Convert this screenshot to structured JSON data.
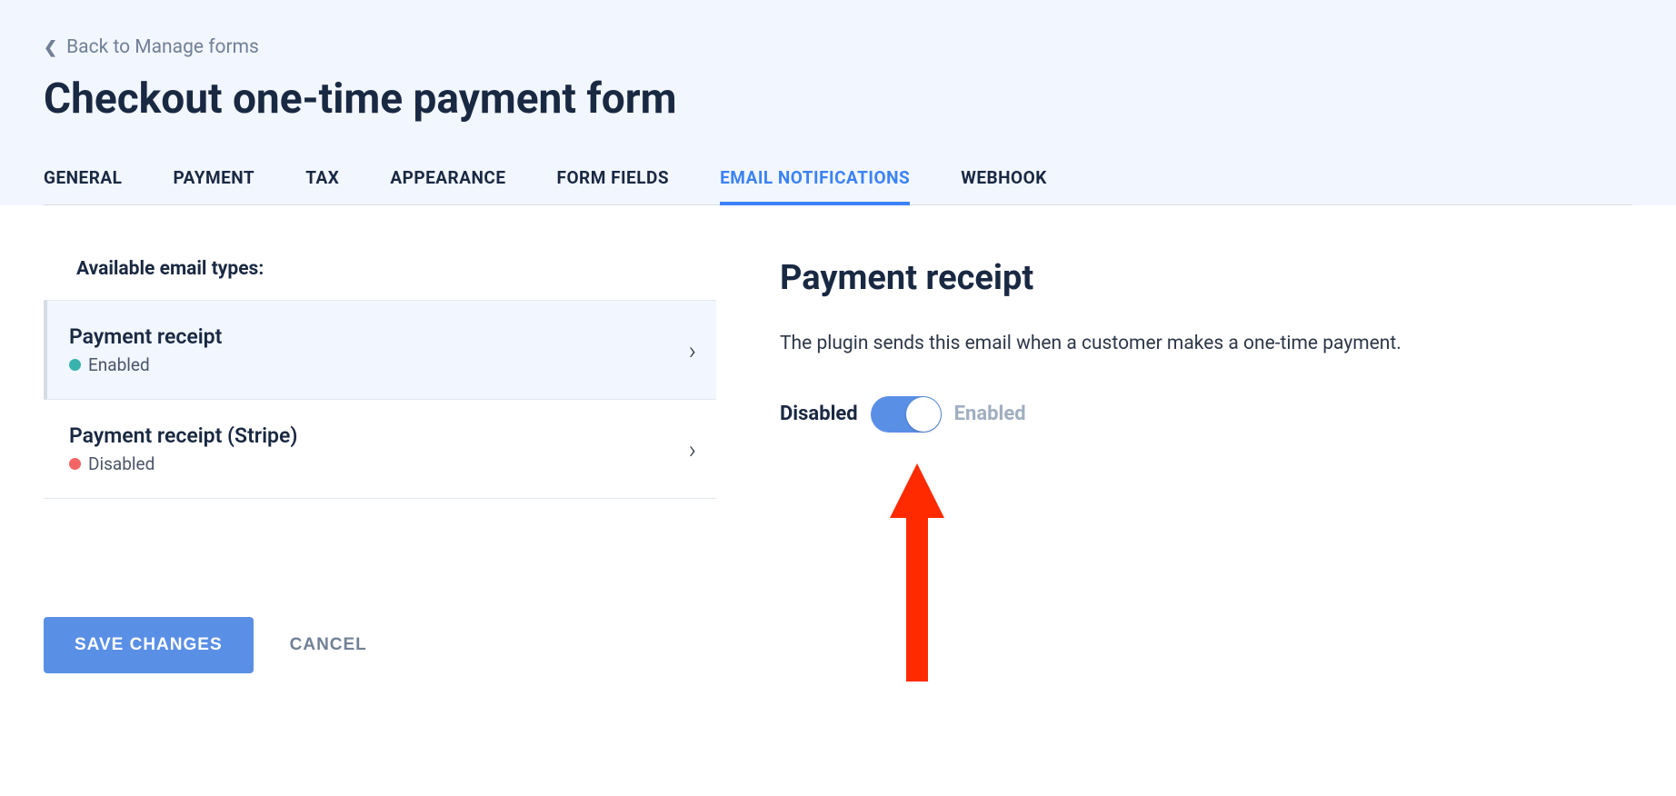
{
  "back_link": "Back to Manage forms",
  "page_title": "Checkout one-time payment form",
  "tabs": [
    {
      "label": "GENERAL",
      "active": false
    },
    {
      "label": "PAYMENT",
      "active": false
    },
    {
      "label": "TAX",
      "active": false
    },
    {
      "label": "APPEARANCE",
      "active": false
    },
    {
      "label": "FORM FIELDS",
      "active": false
    },
    {
      "label": "EMAIL NOTIFICATIONS",
      "active": true
    },
    {
      "label": "WEBHOOK",
      "active": false
    }
  ],
  "section_label": "Available email types:",
  "email_types": [
    {
      "title": "Payment receipt",
      "status": "Enabled",
      "status_kind": "enabled",
      "selected": true
    },
    {
      "title": "Payment receipt (Stripe)",
      "status": "Disabled",
      "status_kind": "disabled",
      "selected": false
    }
  ],
  "detail": {
    "title": "Payment receipt",
    "description": "The plugin sends this email when a customer makes a one-time payment.",
    "toggle_left": "Disabled",
    "toggle_right": "Enabled"
  },
  "buttons": {
    "save": "SAVE CHANGES",
    "cancel": "CANCEL"
  }
}
